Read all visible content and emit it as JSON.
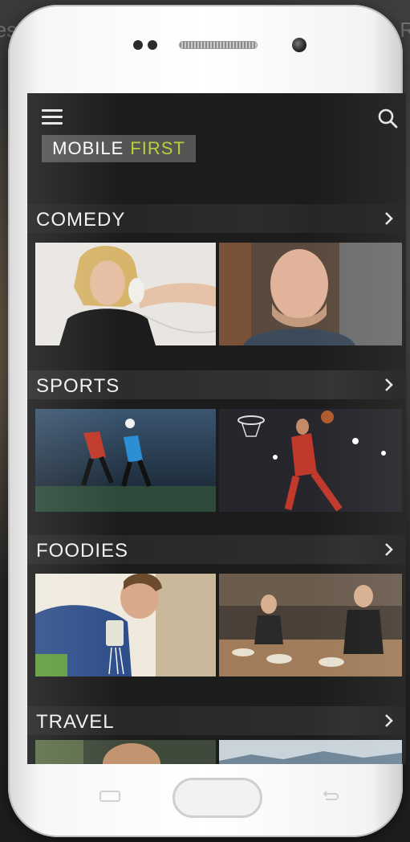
{
  "background": {
    "left_fragment": "ies",
    "right_fragment": "R"
  },
  "app": {
    "logo_part1": "MOBILΕ",
    "logo_part2": "FIRST",
    "accent_color": "#b8d13a",
    "menu_icon": "hamburger-menu-icon",
    "search_icon": "search-icon"
  },
  "sections": [
    {
      "title": "COMEDY",
      "thumbnails": [
        "comedian-with-telephone-photo",
        "smiling-comedian-photo"
      ]
    },
    {
      "title": "SPORTS",
      "thumbnails": [
        "soccer-players-photo",
        "basketball-dunk-photo"
      ]
    },
    {
      "title": "FOODIES",
      "thumbnails": [
        "chef-seasoning-dish-photo",
        "restaurant-kitchen-photo"
      ]
    },
    {
      "title": "TRAVEL",
      "thumbnails": [
        "travel-person-photo",
        "mountain-landscape-photo"
      ]
    }
  ]
}
